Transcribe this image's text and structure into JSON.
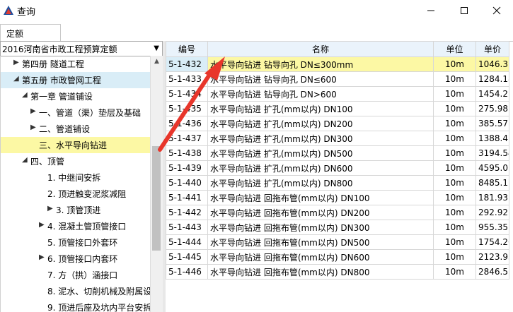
{
  "window": {
    "title": "查询"
  },
  "tabs": [
    {
      "label": "定额"
    }
  ],
  "quota_library": {
    "selected": "2016河南省市政工程预算定额"
  },
  "tree": [
    {
      "label": "第四册 隧道工程",
      "expander": "collapsed"
    },
    {
      "label": "第五册 市政管网工程",
      "expander": "expanded"
    },
    {
      "label": "第一章 管道铺设",
      "expander": "expanded"
    },
    {
      "label": "一、管道（渠）垫层及基础",
      "expander": "collapsed"
    },
    {
      "label": "二、管道铺设",
      "expander": "collapsed"
    },
    {
      "label": "三、水平导向钻进",
      "expander": "none"
    },
    {
      "label": "四、顶管",
      "expander": "expanded"
    },
    {
      "label": "1. 中继间安拆",
      "expander": "none"
    },
    {
      "label": "2. 顶进触变泥浆减阻",
      "expander": "none"
    },
    {
      "label": "3. 顶管顶进",
      "expander": "collapsed"
    },
    {
      "label": "4. 混凝土管顶管接口",
      "expander": "collapsed"
    },
    {
      "label": "5. 顶管接口外套环",
      "expander": "none"
    },
    {
      "label": "6. 顶管接口内套环",
      "expander": "collapsed"
    },
    {
      "label": "7. 方（拱）涵接口",
      "expander": "none"
    },
    {
      "label": "8. 泥水、切削机械及附属设",
      "expander": "none"
    },
    {
      "label": "9. 顶进后座及坑内平台安拆",
      "expander": "none"
    }
  ],
  "grid": {
    "columns": {
      "code": "编号",
      "name": "名称",
      "unit": "单位",
      "price": "单价"
    },
    "rows": [
      {
        "code": "5-1-432",
        "name": "水平导向钻进 钻导向孔 DN≤300mm",
        "unit": "10m",
        "price": "1046.37"
      },
      {
        "code": "5-1-433",
        "name": "水平导向钻进 钻导向孔 DN≤600",
        "unit": "10m",
        "price": "1284.18"
      },
      {
        "code": "5-1-434",
        "name": "水平导向钻进 钻导向孔 DN>600",
        "unit": "10m",
        "price": "1454.2"
      },
      {
        "code": "5-1-435",
        "name": "水平导向钻进 扩孔(mm以内) DN100",
        "unit": "10m",
        "price": "275.98"
      },
      {
        "code": "5-1-436",
        "name": "水平导向钻进 扩孔(mm以内) DN200",
        "unit": "10m",
        "price": "385.57"
      },
      {
        "code": "5-1-437",
        "name": "水平导向钻进 扩孔(mm以内) DN300",
        "unit": "10m",
        "price": "1388.47"
      },
      {
        "code": "5-1-438",
        "name": "水平导向钻进 扩孔(mm以内) DN500",
        "unit": "10m",
        "price": "3194.54"
      },
      {
        "code": "5-1-439",
        "name": "水平导向钻进 扩孔(mm以内) DN600",
        "unit": "10m",
        "price": "4595.01"
      },
      {
        "code": "5-1-440",
        "name": "水平导向钻进 扩孔(mm以内) DN800",
        "unit": "10m",
        "price": "8485.17"
      },
      {
        "code": "5-1-441",
        "name": "水平导向钻进 回拖布管(mm以内) DN100",
        "unit": "10m",
        "price": "181.93"
      },
      {
        "code": "5-1-442",
        "name": "水平导向钻进 回拖布管(mm以内) DN200",
        "unit": "10m",
        "price": "292.92"
      },
      {
        "code": "5-1-443",
        "name": "水平导向钻进 回拖布管(mm以内) DN300",
        "unit": "10m",
        "price": "955.35"
      },
      {
        "code": "5-1-444",
        "name": "水平导向钻进 回拖布管(mm以内) DN500",
        "unit": "10m",
        "price": "1754.26"
      },
      {
        "code": "5-1-445",
        "name": "水平导向钻进 回拖布管(mm以内) DN600",
        "unit": "10m",
        "price": "2123.93"
      },
      {
        "code": "5-1-446",
        "name": "水平导向钻进 回拖布管(mm以内) DN800",
        "unit": "10m",
        "price": "2846.51"
      }
    ]
  },
  "colors": {
    "selection_yellow": "#fcf8a4",
    "selection_blue": "#d9edf7",
    "annotation_arrow": "#e8362b"
  }
}
